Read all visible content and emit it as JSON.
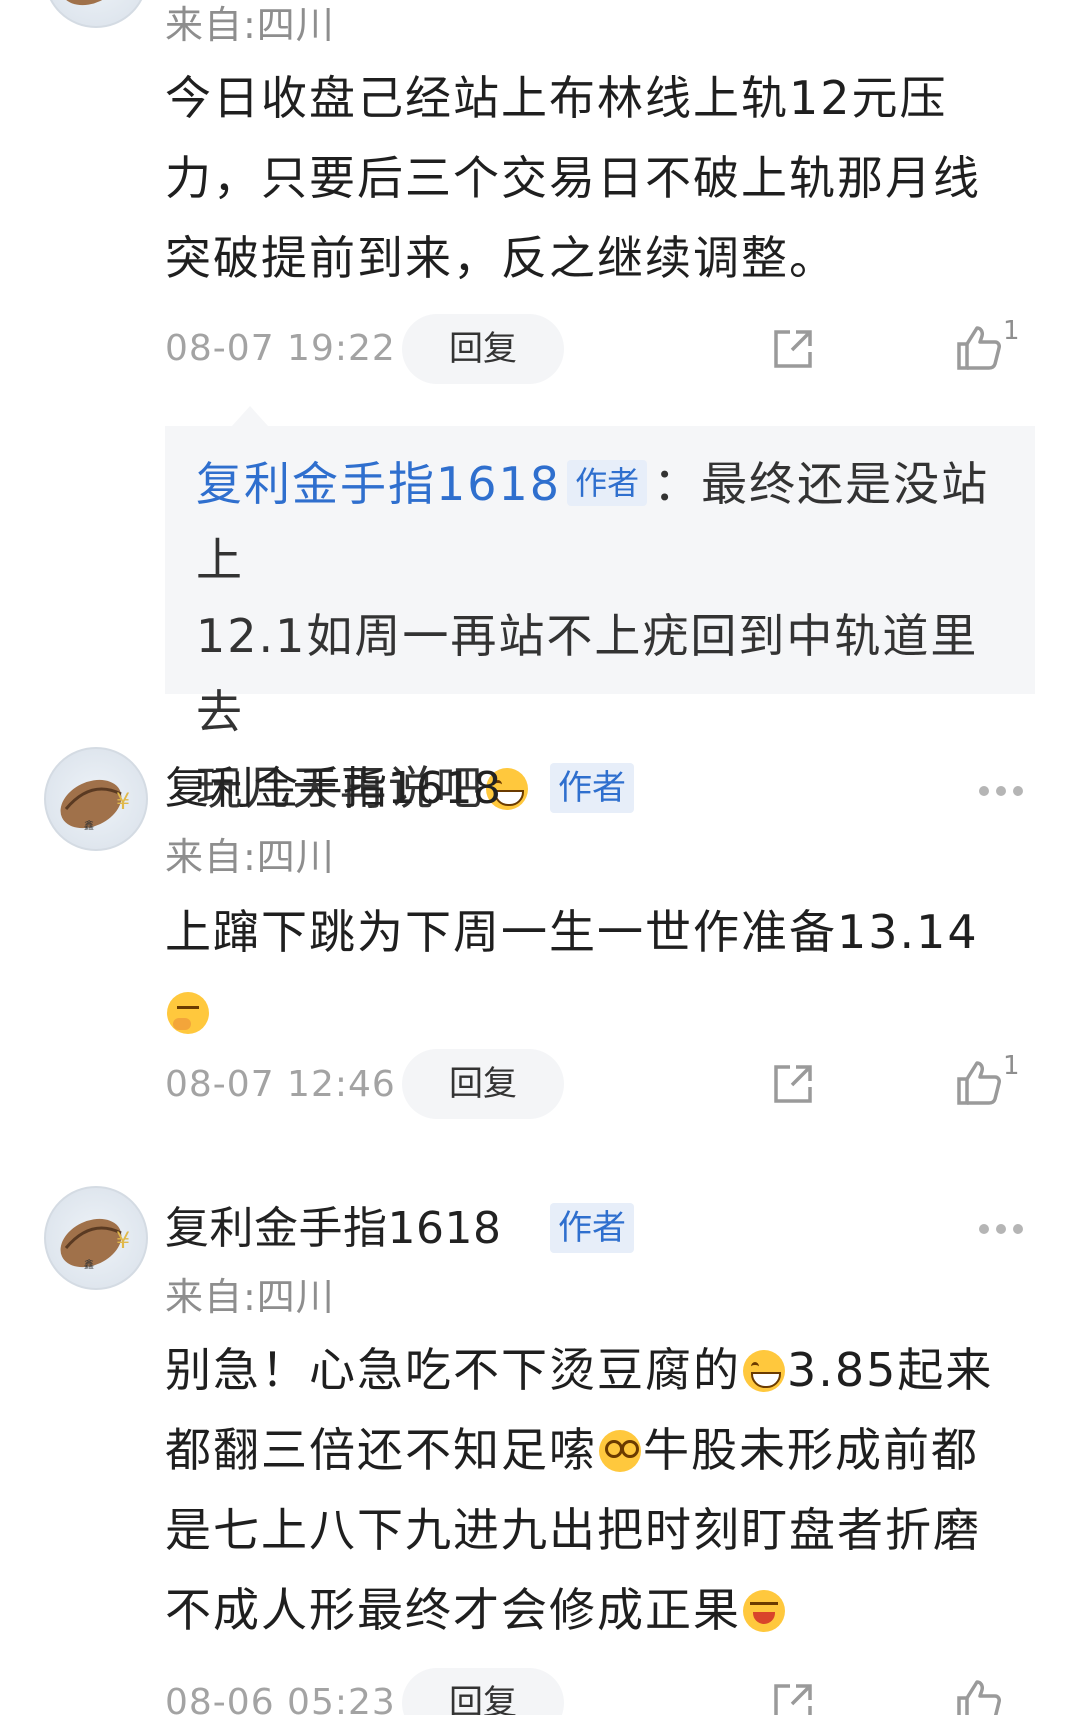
{
  "comments": [
    {
      "location": "来自:四川",
      "content_lines": [
        "今日收盘己经站上布林线上轨12元压",
        "力，只要后三个交易日不破上轨那月线",
        "突破提前到来，反之继续调整。"
      ],
      "time": "08-07 19:22",
      "reply_label": "回复",
      "like_count": "1",
      "quoted_reply": {
        "name": "复利金手指1618",
        "tag": "作者",
        "separator": "：",
        "line1": "最终还是没站上",
        "line2": "12.1如周一再站不上疣回到中轨道里去",
        "line3": "玩几天再说吧",
        "emoji": "grin-emoji"
      }
    },
    {
      "name": "复利金手指1618",
      "tag": "作者",
      "location": "来自:四川",
      "content_line1": "上蹿下跳为下周一生一世作准备13.14",
      "emoji": "thinking-emoji",
      "time": "08-07 12:46",
      "reply_label": "回复",
      "like_count": "1"
    },
    {
      "name": "复利金手指1618",
      "tag": "作者",
      "location": "来自:四川",
      "line1_a": "别急！心急吃不下烫豆腐的",
      "line1_b": "3.85起来",
      "line2_a": "都翻三倍还不知足嗦",
      "line2_b": "牛股未形成前都",
      "line3": "是七上八下九进九出把时刻盯盘者折磨",
      "line4": "不成人形最终才会修成正果",
      "time": "08-06 05:23",
      "reply_label": "回复"
    }
  ],
  "colors": {
    "author_blue": "#2f6fce",
    "tag_bg": "#e7eef9",
    "muted": "#8e8e8e"
  }
}
